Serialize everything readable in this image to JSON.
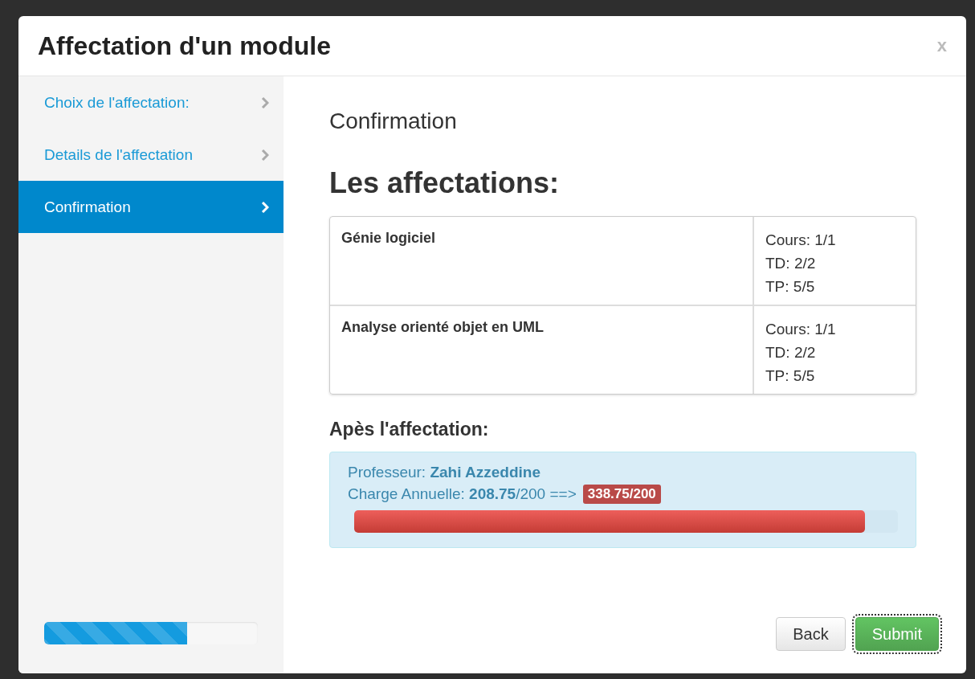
{
  "dialog": {
    "title": "Affectation d'un module",
    "close": "x"
  },
  "steps": [
    {
      "label": "Choix de l'affectation:",
      "selected": false
    },
    {
      "label": "Details de l'affectation",
      "selected": false
    },
    {
      "label": "Confirmation",
      "selected": true
    }
  ],
  "wizard_progress": {
    "level": 0.67
  },
  "content": {
    "heading": "Confirmation",
    "subheading": "Les affectations:",
    "assignments": [
      {
        "module": "Génie logiciel",
        "details": [
          "Cours: 1/1",
          "TD: 2/2",
          "TP: 5/5"
        ]
      },
      {
        "module": "Analyse orienté objet en UML",
        "details": [
          "Cours: 1/1",
          "TD: 2/2",
          "TP: 5/5"
        ]
      }
    ],
    "after_heading": "Apès l'affectation:",
    "summary": {
      "professor": "Professeur: **Zahi Azzeddine**",
      "charge": "Charge Annuelle: **208.75**/200 ==>",
      "charge_new": "338.75/200",
      "level": 0.94
    }
  },
  "buttons": [
    {
      "label": "Back",
      "kind": "default",
      "focused": false
    },
    {
      "label": "Submit",
      "kind": "primary",
      "focused": true
    }
  ]
}
